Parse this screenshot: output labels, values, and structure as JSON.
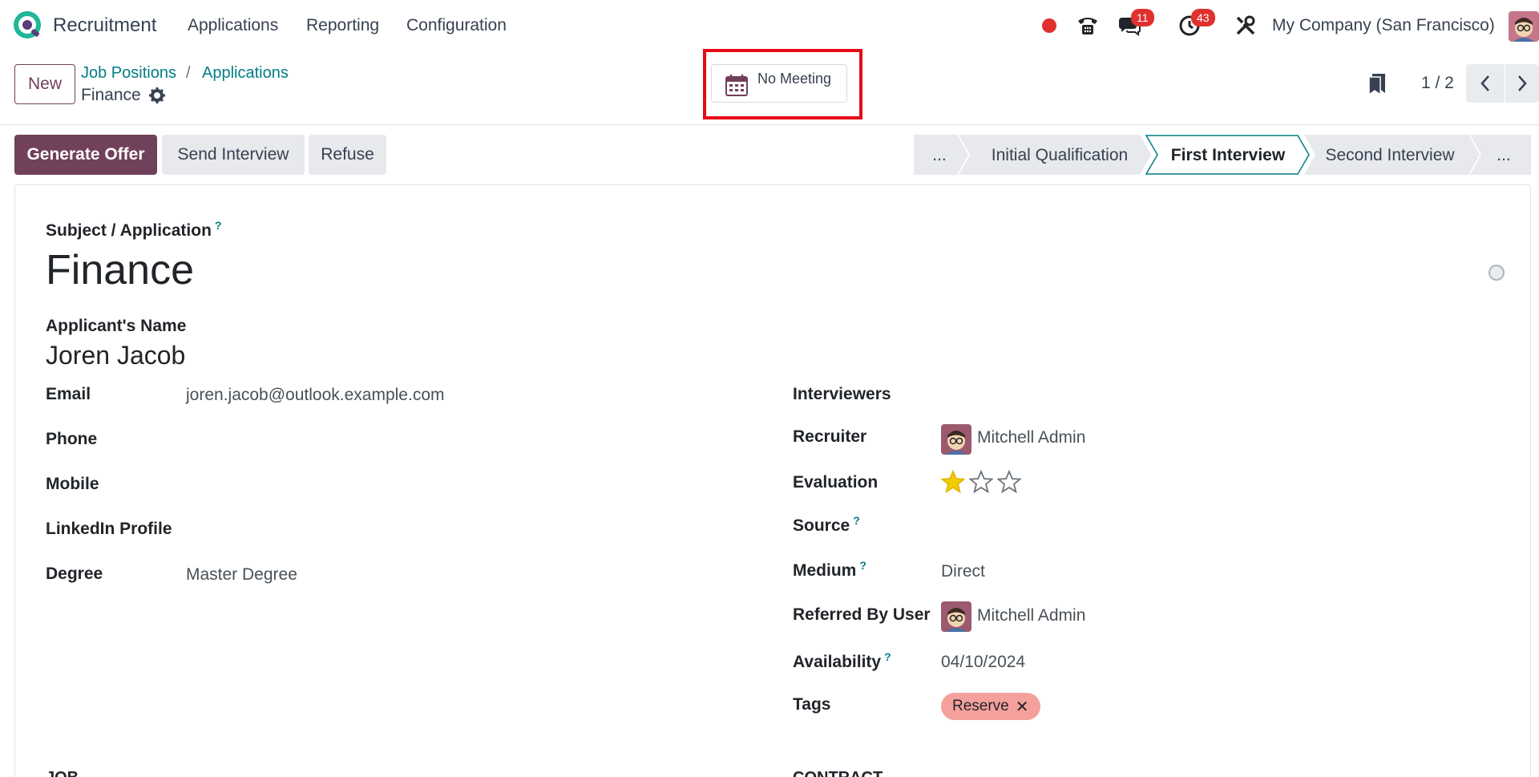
{
  "navbar": {
    "app_name": "Recruitment",
    "menus": [
      "Applications",
      "Reporting",
      "Configuration"
    ],
    "messages_count": "11",
    "activities_count": "43",
    "company": "My Company (San Francisco)"
  },
  "control": {
    "new_label": "New",
    "breadcrumbs": [
      "Job Positions",
      "Applications"
    ],
    "breadcrumb_sep": "/",
    "record_name": "Finance",
    "meeting_label": "No Meeting",
    "pager": "1 / 2"
  },
  "actions": {
    "generate_offer": "Generate Offer",
    "send_interview": "Send Interview",
    "refuse": "Refuse"
  },
  "stages": {
    "items": [
      "...",
      "Initial Qualification",
      "First Interview",
      "Second Interview",
      "..."
    ],
    "active_index": 2
  },
  "form": {
    "subject_label": "Subject / Application",
    "subject_value": "Finance",
    "applicant_label": "Applicant's Name",
    "applicant_value": "Joren Jacob",
    "email_label": "Email",
    "email_value": "joren.jacob@outlook.example.com",
    "phone_label": "Phone",
    "mobile_label": "Mobile",
    "linkedin_label": "LinkedIn Profile",
    "degree_label": "Degree",
    "degree_value": "Master Degree",
    "interviewers_label": "Interviewers",
    "recruiter_label": "Recruiter",
    "recruiter_value": "Mitchell Admin",
    "evaluation_label": "Evaluation",
    "evaluation_stars": 1,
    "evaluation_max": 3,
    "source_label": "Source",
    "medium_label": "Medium",
    "medium_value": "Direct",
    "referred_label": "Referred By User",
    "referred_value": "Mitchell Admin",
    "availability_label": "Availability",
    "availability_value": "04/10/2024",
    "tags_label": "Tags",
    "tag_value": "Reserve",
    "help_mark": "?",
    "section_left": "JOB",
    "section_right": "CONTRACT"
  },
  "colors": {
    "brand": "#71405a",
    "link": "#017e84",
    "badge": "#e0312f",
    "highlight": "#e50914",
    "tag": "#f4a09c"
  }
}
